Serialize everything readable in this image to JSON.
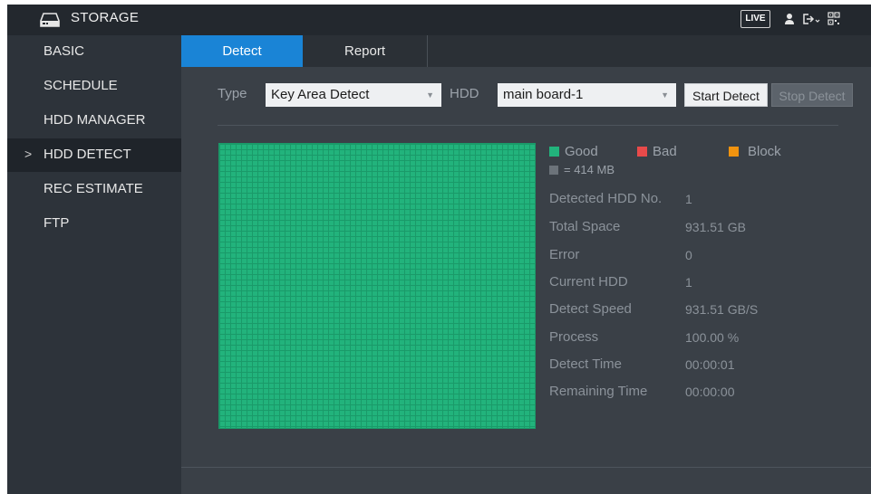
{
  "header": {
    "title": "STORAGE",
    "live_label": "LIVE",
    "icons": [
      "hdd-icon",
      "user-icon",
      "logout-icon",
      "qr-code-icon"
    ]
  },
  "sidebar": {
    "items": [
      {
        "label": "BASIC"
      },
      {
        "label": "SCHEDULE"
      },
      {
        "label": "HDD MANAGER"
      },
      {
        "label": "HDD DETECT",
        "active": true,
        "caret": ">"
      },
      {
        "label": "REC ESTIMATE"
      },
      {
        "label": "FTP"
      }
    ]
  },
  "tabs": [
    {
      "label": "Detect",
      "active": true
    },
    {
      "label": "Report"
    }
  ],
  "filters": {
    "type_label": "Type",
    "type_value": "Key Area Detect",
    "hdd_label": "HDD",
    "hdd_value": "main board-1",
    "start_button": "Start Detect",
    "stop_button": "Stop Detect"
  },
  "legend": {
    "good": "Good",
    "bad": "Bad",
    "block": "Block",
    "unit": "= 414 MB",
    "colors": {
      "good": "#22b37c",
      "bad": "#e84a4a",
      "block": "#f0930f",
      "unit": "#6c737a"
    }
  },
  "detection": {
    "grid_status": "all-good",
    "detected_hdd_no_label": "Detected HDD No.",
    "detected_hdd_no": "1",
    "total_space_label": "Total Space",
    "total_space": "931.51 GB",
    "error_label": "Error",
    "error": "0",
    "current_hdd_label": "Current HDD",
    "current_hdd": "1",
    "detect_speed_label": "Detect Speed",
    "detect_speed": "931.51 GB/S",
    "process_label": "Process",
    "process": "100.00 %",
    "detect_time_label": "Detect Time",
    "detect_time": "00:00:01",
    "remaining_time_label": "Remaining Time",
    "remaining_time": "00:00:00"
  },
  "colors": {
    "accent": "#1a84d6",
    "sidebar_bg": "#2d333a",
    "content_bg": "#3a4047"
  }
}
